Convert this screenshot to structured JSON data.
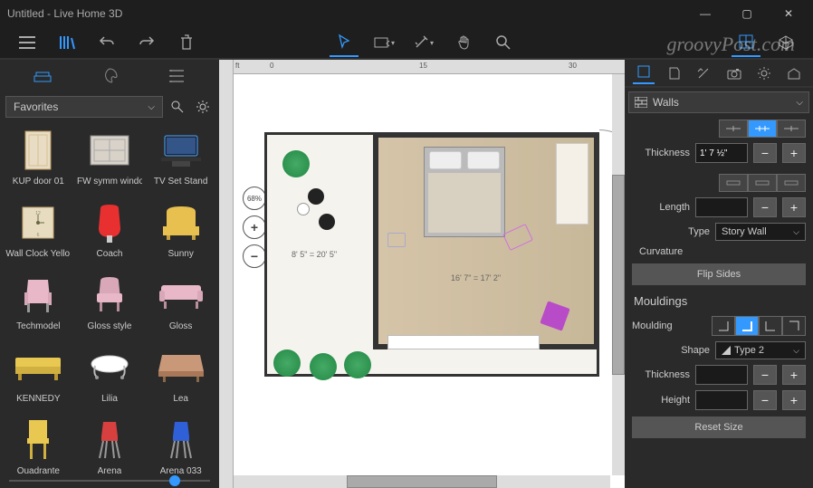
{
  "window": {
    "title": "Untitled - Live Home 3D",
    "minimize": "—",
    "maximize": "▢",
    "close": "✕"
  },
  "library": {
    "category": "Favorites",
    "items": [
      {
        "label": "KUP door 01"
      },
      {
        "label": "FW symm windo…"
      },
      {
        "label": "TV Set Stand"
      },
      {
        "label": "Wall Clock Yello…"
      },
      {
        "label": "Coach"
      },
      {
        "label": "Sunny"
      },
      {
        "label": "Techmodel"
      },
      {
        "label": "Gloss style"
      },
      {
        "label": "Gloss"
      },
      {
        "label": "KENNEDY"
      },
      {
        "label": "Lilia"
      },
      {
        "label": "Lea"
      },
      {
        "label": "Quadrante"
      },
      {
        "label": "Arena"
      },
      {
        "label": "Arena 033"
      }
    ]
  },
  "canvas": {
    "zoom": "68%",
    "dim_left": "8' 5\" = 20' 5\"",
    "dim_room": "16' 7\" = 17' 2\"",
    "ruler_ft": "ft",
    "ruler_0": "0",
    "ruler_15": "15",
    "ruler_30": "30"
  },
  "inspector": {
    "object": "Walls",
    "thickness_label": "Thickness",
    "thickness_value": "1' 7 ½\"",
    "length_label": "Length",
    "length_value": "",
    "type_label": "Type",
    "type_value": "Story Wall",
    "curvature_label": "Curvature",
    "flip_label": "Flip Sides",
    "mouldings_header": "Mouldings",
    "moulding_label": "Moulding",
    "shape_label": "Shape",
    "shape_value": "Type 2",
    "m_thickness_label": "Thickness",
    "m_thickness_value": "",
    "height_label": "Height",
    "height_value": "",
    "reset_label": "Reset Size"
  },
  "watermark": "groovyPost.com"
}
